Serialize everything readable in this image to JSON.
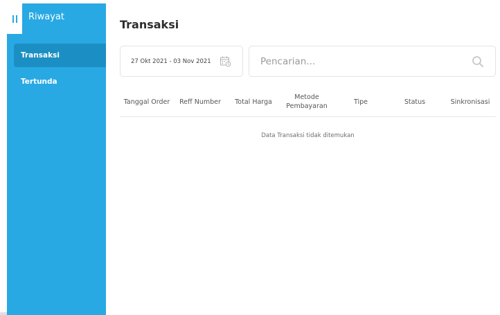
{
  "sidebar": {
    "title": "Riwayat",
    "items": [
      {
        "label": "Transaksi",
        "active": true
      },
      {
        "label": "Tertunda",
        "active": false
      }
    ]
  },
  "main": {
    "title": "Transaksi",
    "date_range": "27 Okt 2021 - 03 Nov 2021",
    "search": {
      "placeholder": "Pencarian...",
      "value": ""
    },
    "table": {
      "headers": [
        "Tanggal Order",
        "Reff Number",
        "Total Harga",
        "Metode\nPembayaran",
        "Tipe",
        "Status",
        "Sinkronisasi"
      ],
      "rows": [],
      "empty_message": "Data Transaksi tidak ditemukan"
    }
  },
  "icons": {
    "menu": "menu-toggle-icon",
    "calendar": "calendar-icon",
    "search": "search-icon"
  },
  "colors": {
    "sidebar": "#28a9e3",
    "sidebar_active": "#1b8fc3",
    "border": "#e3e3e3",
    "text": "#2d2d2d"
  }
}
